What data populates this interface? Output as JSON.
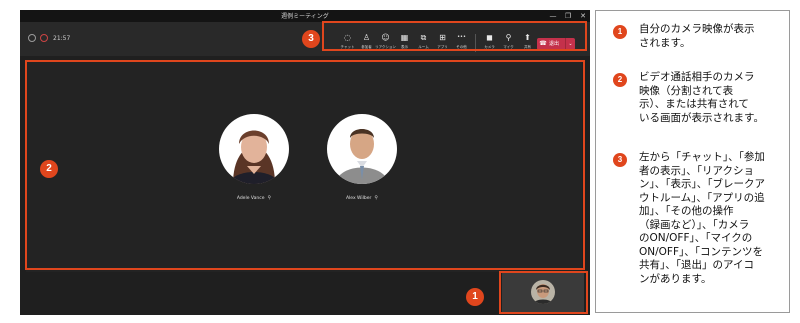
{
  "window": {
    "title": "週例ミーティング",
    "controls": [
      "—",
      "❐",
      "✕"
    ]
  },
  "status": {
    "timer": "21:57"
  },
  "toolbar": {
    "buttons": [
      {
        "label": "チャット",
        "icon": "chat-icon",
        "glyph": "◌"
      },
      {
        "label": "参加者",
        "icon": "people-icon",
        "glyph": "♙"
      },
      {
        "label": "リアクション",
        "icon": "reaction-icon",
        "glyph": "☺"
      },
      {
        "label": "表示",
        "icon": "view-icon",
        "glyph": "▦"
      },
      {
        "label": "ルーム",
        "icon": "rooms-icon",
        "glyph": "⧉"
      },
      {
        "label": "アプリ",
        "icon": "apps-icon",
        "glyph": "⊞"
      },
      {
        "label": "その他",
        "icon": "more-icon",
        "glyph": "•••"
      },
      {
        "label": "カメラ",
        "icon": "camera-icon",
        "glyph": "◼"
      },
      {
        "label": "マイク",
        "icon": "mic-off-icon",
        "glyph": "⚲"
      },
      {
        "label": "共有",
        "icon": "share-icon",
        "glyph": "⬆"
      }
    ],
    "leave": {
      "label": "退出",
      "icon": "phone-hangup-icon",
      "dropdown_icon": "chevron-down-icon"
    }
  },
  "participants": [
    {
      "name": "Adele Vance",
      "mic_icon": "mic-muted-icon"
    },
    {
      "name": "Alex Wilber",
      "mic_icon": "mic-muted-icon"
    }
  ],
  "annotations": {
    "badge1": "1",
    "badge2": "2",
    "badge3": "3"
  },
  "explanations": [
    {
      "num": "1",
      "text": "自分のカメラ映像が表示\nされます。"
    },
    {
      "num": "2",
      "text": "ビデオ通話相手のカメラ\n映像（分割されて表\n示）、または共有されて\nいる画面が表示されます。"
    },
    {
      "num": "3",
      "text": "左から「チャット」、「参加\n者の表示」、「リアクショ\nン」、「表示」、「ブレークア\nウトルーム」、「アプリの追\n加」、「その他の操作\n（録画など）」、「カメラ\nのON/OFF」、「マイクの\nON/OFF」、「コンテンツを\n共有」、「退出」のアイコ\nンがあります。"
    }
  ],
  "colors": {
    "accent_orange": "#e0461d",
    "leave_red": "#c4314b",
    "window_bg": "#1f1f1f"
  }
}
